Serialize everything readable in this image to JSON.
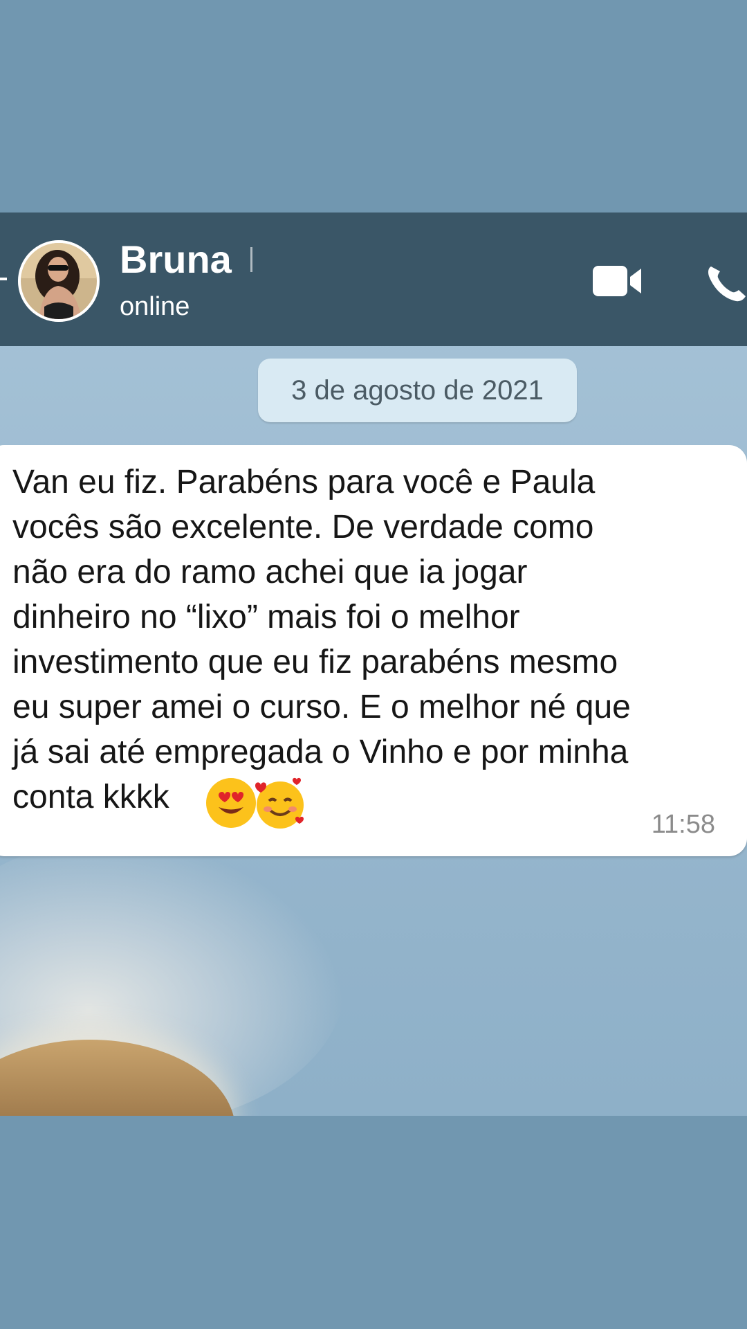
{
  "header": {
    "contact_name": "Bruna",
    "status": "online",
    "back_icon": "back-arrow-icon",
    "video_icon": "video-camera-icon",
    "phone_icon": "phone-icon"
  },
  "chat": {
    "date_divider": "3 de agosto de 2021",
    "messages": [
      {
        "text": "Van eu fiz. Parabéns para você e Paula\nvocês são excelente. De verdade como\nnão era do ramo achei que ia jogar\ndinheiro no “lixo” mais foi o melhor\ninvestimento que eu fiz parabéns mesmo\neu super amei o curso. E o melhor né que\njá sai até empregada o Vinho e por minha\nconta kkkk",
        "emojis": [
          "heart-eyes-emoji",
          "smiling-face-with-hearts-emoji"
        ],
        "time": "11:58"
      }
    ]
  },
  "colors": {
    "outer_background": "#7197b0",
    "header_background": "#3a5667",
    "date_chip_background": "#d9eaf3",
    "bubble_background": "#ffffff",
    "time_text": "#8b8b8b"
  }
}
